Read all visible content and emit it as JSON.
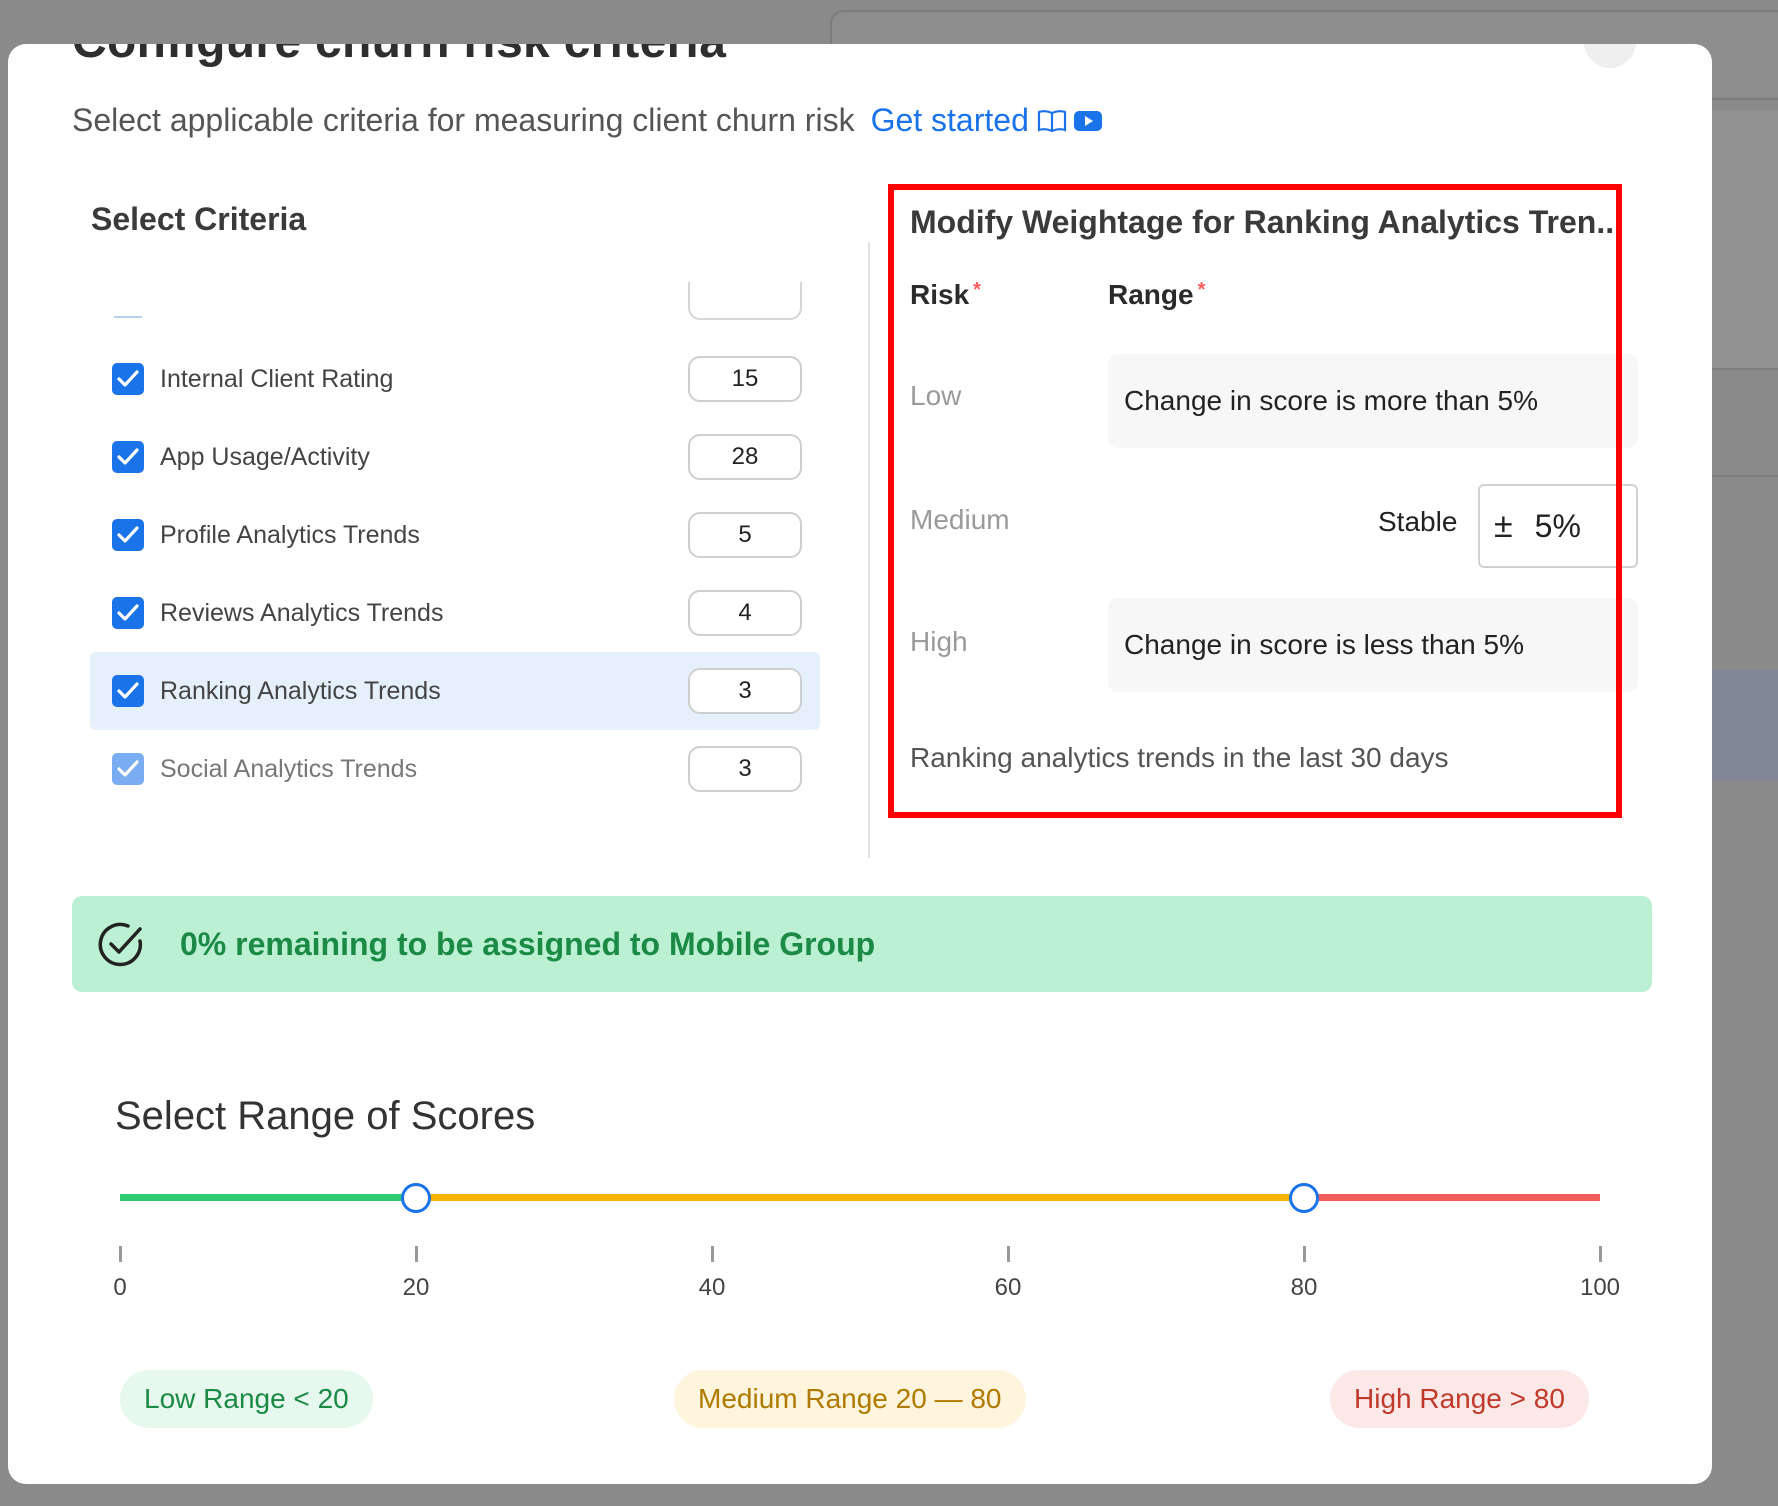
{
  "modal": {
    "title": "Configure churn risk criteria",
    "subtitle": "Select applicable criteria for measuring client churn risk",
    "get_started_label": "Get started"
  },
  "criteria": {
    "title": "Select Criteria",
    "items": [
      {
        "label": "Internal Client Rating",
        "weight": "15",
        "checked": true
      },
      {
        "label": "App Usage/Activity",
        "weight": "28",
        "checked": true
      },
      {
        "label": "Profile Analytics Trends",
        "weight": "5",
        "checked": true
      },
      {
        "label": "Reviews Analytics Trends",
        "weight": "4",
        "checked": true
      },
      {
        "label": "Ranking Analytics Trends",
        "weight": "3",
        "checked": true,
        "selected": true
      },
      {
        "label": "Social Analytics Trends",
        "weight": "3",
        "checked": true,
        "disabled": true
      }
    ]
  },
  "weightage": {
    "title": "Modify Weightage for Ranking Analytics Tren...",
    "risk_header": "Risk",
    "range_header": "Range",
    "required_mark": "*",
    "low_label": "Low",
    "low_range": "Change in score is more than 5%",
    "medium_label": "Medium",
    "medium_stable_label": "Stable",
    "medium_plus_minus": "±",
    "medium_value": "5%",
    "high_label": "High",
    "high_range": "Change in score is less than 5%",
    "footnote": "Ranking analytics trends in the last 30 days"
  },
  "banner": {
    "text": "0% remaining to be assigned to Mobile Group",
    "color": "#1a8a45",
    "background": "#bcf0d3"
  },
  "range_scores": {
    "title": "Select Range of Scores",
    "min": 0,
    "max": 100,
    "low_threshold": 20,
    "high_threshold": 80,
    "ticks": [
      "0",
      "20",
      "40",
      "60",
      "80",
      "100"
    ],
    "colors": {
      "low": "#2ecc71",
      "medium": "#f5b400",
      "high": "#f25c5c",
      "handle": "#1a73e8"
    },
    "low_badge": "Low Range < 20",
    "medium_badge": "Medium Range 20 — 80",
    "high_badge": "High Range > 80"
  },
  "icons": {
    "get_started_book": "book-open-icon",
    "get_started_video": "video-play-icon",
    "checkbox": "checkmark-icon",
    "banner": "circle-check-icon",
    "close": "close-icon"
  }
}
